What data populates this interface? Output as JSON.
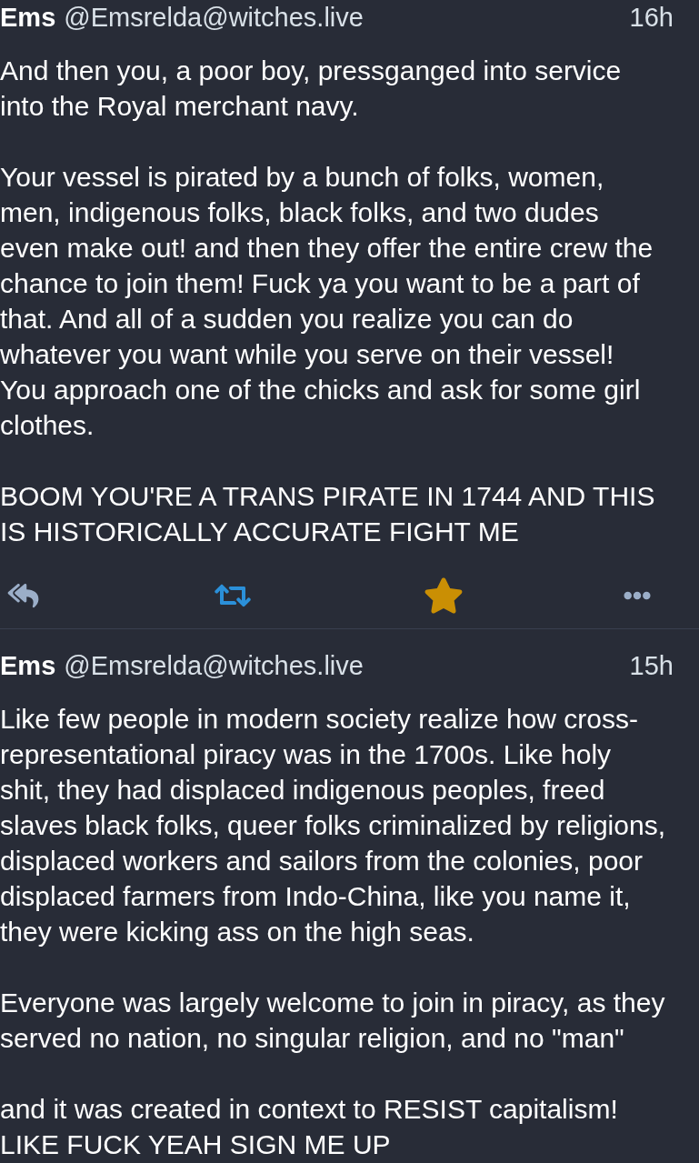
{
  "posts": [
    {
      "display_name": "Ems",
      "handle": "@Emsrelda@witches.live",
      "time": "16h",
      "paragraphs": [
        "And then you, a poor boy, pressganged into service into the Royal merchant navy.",
        "Your vessel is pirated by a bunch of folks, women, men, indigenous folks, black folks, and two dudes even make out! and then they offer the entire crew the chance to join them! Fuck ya you want to be a part of that. And all of a sudden you realize you can do whatever you want while you serve on their vessel! You approach one of the chicks and ask for some girl clothes.",
        "BOOM YOU'RE A TRANS PIRATE IN 1744 AND THIS IS HISTORICALLY ACCURATE FIGHT ME"
      ],
      "actions": {
        "boosted": true,
        "favourited": true
      }
    },
    {
      "display_name": "Ems",
      "handle": "@Emsrelda@witches.live",
      "time": "15h",
      "paragraphs": [
        "Like few people in modern society realize how cross-representational piracy was in the 1700s. Like holy shit, they had displaced indigenous peoples, freed slaves black folks, queer folks criminalized by religions, displaced workers and sailors from the colonies, poor displaced farmers from Indo-China, like you name it, they were kicking ass on the high seas.",
        "Everyone was largely welcome to join in piracy, as they served no nation, no singular religion, and no \"man\"",
        "and it was created in context to RESIST capitalism! LIKE FUCK YEAH SIGN ME UP"
      ]
    }
  ]
}
